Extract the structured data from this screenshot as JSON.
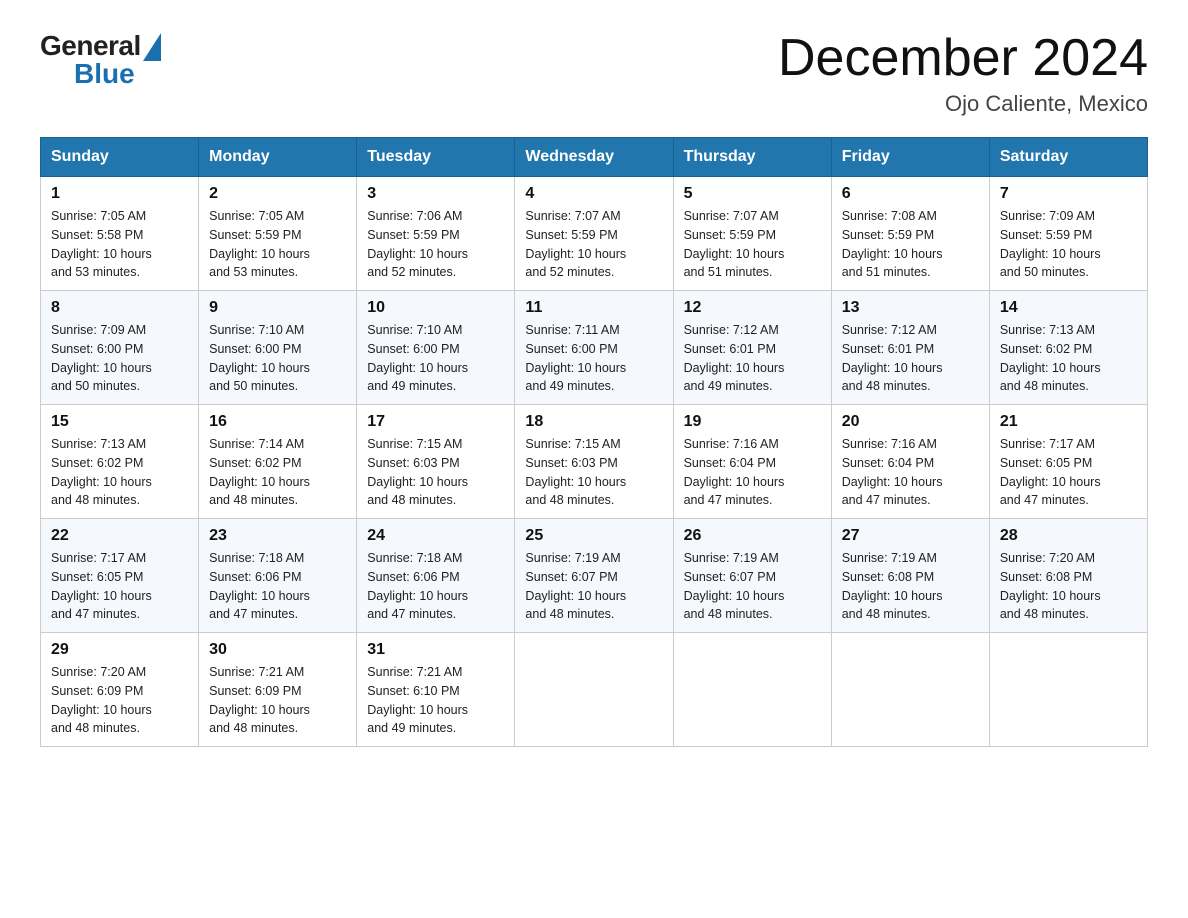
{
  "logo": {
    "text_general": "General",
    "text_blue": "Blue"
  },
  "title": {
    "month_year": "December 2024",
    "location": "Ojo Caliente, Mexico"
  },
  "days_of_week": [
    "Sunday",
    "Monday",
    "Tuesday",
    "Wednesday",
    "Thursday",
    "Friday",
    "Saturday"
  ],
  "weeks": [
    [
      {
        "day": "1",
        "sunrise": "7:05 AM",
        "sunset": "5:58 PM",
        "daylight": "10 hours and 53 minutes."
      },
      {
        "day": "2",
        "sunrise": "7:05 AM",
        "sunset": "5:59 PM",
        "daylight": "10 hours and 53 minutes."
      },
      {
        "day": "3",
        "sunrise": "7:06 AM",
        "sunset": "5:59 PM",
        "daylight": "10 hours and 52 minutes."
      },
      {
        "day": "4",
        "sunrise": "7:07 AM",
        "sunset": "5:59 PM",
        "daylight": "10 hours and 52 minutes."
      },
      {
        "day": "5",
        "sunrise": "7:07 AM",
        "sunset": "5:59 PM",
        "daylight": "10 hours and 51 minutes."
      },
      {
        "day": "6",
        "sunrise": "7:08 AM",
        "sunset": "5:59 PM",
        "daylight": "10 hours and 51 minutes."
      },
      {
        "day": "7",
        "sunrise": "7:09 AM",
        "sunset": "5:59 PM",
        "daylight": "10 hours and 50 minutes."
      }
    ],
    [
      {
        "day": "8",
        "sunrise": "7:09 AM",
        "sunset": "6:00 PM",
        "daylight": "10 hours and 50 minutes."
      },
      {
        "day": "9",
        "sunrise": "7:10 AM",
        "sunset": "6:00 PM",
        "daylight": "10 hours and 50 minutes."
      },
      {
        "day": "10",
        "sunrise": "7:10 AM",
        "sunset": "6:00 PM",
        "daylight": "10 hours and 49 minutes."
      },
      {
        "day": "11",
        "sunrise": "7:11 AM",
        "sunset": "6:00 PM",
        "daylight": "10 hours and 49 minutes."
      },
      {
        "day": "12",
        "sunrise": "7:12 AM",
        "sunset": "6:01 PM",
        "daylight": "10 hours and 49 minutes."
      },
      {
        "day": "13",
        "sunrise": "7:12 AM",
        "sunset": "6:01 PM",
        "daylight": "10 hours and 48 minutes."
      },
      {
        "day": "14",
        "sunrise": "7:13 AM",
        "sunset": "6:02 PM",
        "daylight": "10 hours and 48 minutes."
      }
    ],
    [
      {
        "day": "15",
        "sunrise": "7:13 AM",
        "sunset": "6:02 PM",
        "daylight": "10 hours and 48 minutes."
      },
      {
        "day": "16",
        "sunrise": "7:14 AM",
        "sunset": "6:02 PM",
        "daylight": "10 hours and 48 minutes."
      },
      {
        "day": "17",
        "sunrise": "7:15 AM",
        "sunset": "6:03 PM",
        "daylight": "10 hours and 48 minutes."
      },
      {
        "day": "18",
        "sunrise": "7:15 AM",
        "sunset": "6:03 PM",
        "daylight": "10 hours and 48 minutes."
      },
      {
        "day": "19",
        "sunrise": "7:16 AM",
        "sunset": "6:04 PM",
        "daylight": "10 hours and 47 minutes."
      },
      {
        "day": "20",
        "sunrise": "7:16 AM",
        "sunset": "6:04 PM",
        "daylight": "10 hours and 47 minutes."
      },
      {
        "day": "21",
        "sunrise": "7:17 AM",
        "sunset": "6:05 PM",
        "daylight": "10 hours and 47 minutes."
      }
    ],
    [
      {
        "day": "22",
        "sunrise": "7:17 AM",
        "sunset": "6:05 PM",
        "daylight": "10 hours and 47 minutes."
      },
      {
        "day": "23",
        "sunrise": "7:18 AM",
        "sunset": "6:06 PM",
        "daylight": "10 hours and 47 minutes."
      },
      {
        "day": "24",
        "sunrise": "7:18 AM",
        "sunset": "6:06 PM",
        "daylight": "10 hours and 47 minutes."
      },
      {
        "day": "25",
        "sunrise": "7:19 AM",
        "sunset": "6:07 PM",
        "daylight": "10 hours and 48 minutes."
      },
      {
        "day": "26",
        "sunrise": "7:19 AM",
        "sunset": "6:07 PM",
        "daylight": "10 hours and 48 minutes."
      },
      {
        "day": "27",
        "sunrise": "7:19 AM",
        "sunset": "6:08 PM",
        "daylight": "10 hours and 48 minutes."
      },
      {
        "day": "28",
        "sunrise": "7:20 AM",
        "sunset": "6:08 PM",
        "daylight": "10 hours and 48 minutes."
      }
    ],
    [
      {
        "day": "29",
        "sunrise": "7:20 AM",
        "sunset": "6:09 PM",
        "daylight": "10 hours and 48 minutes."
      },
      {
        "day": "30",
        "sunrise": "7:21 AM",
        "sunset": "6:09 PM",
        "daylight": "10 hours and 48 minutes."
      },
      {
        "day": "31",
        "sunrise": "7:21 AM",
        "sunset": "6:10 PM",
        "daylight": "10 hours and 49 minutes."
      },
      null,
      null,
      null,
      null
    ]
  ],
  "labels": {
    "sunrise": "Sunrise:",
    "sunset": "Sunset:",
    "daylight": "Daylight:"
  }
}
